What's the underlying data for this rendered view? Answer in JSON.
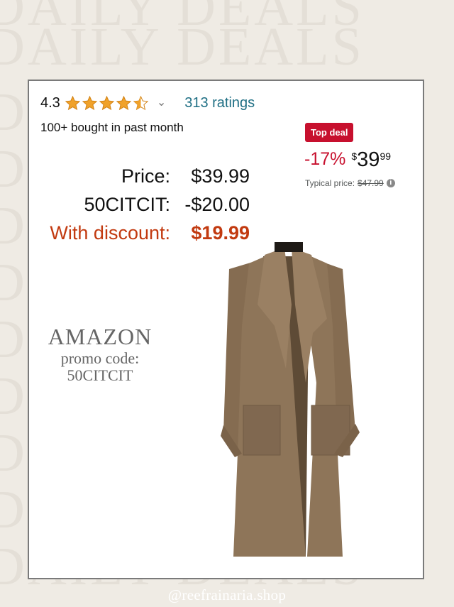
{
  "background": {
    "watermark_text": "DAILY DEALS"
  },
  "listing": {
    "rating_value": "4.3",
    "stars_filled": 4.3,
    "ratings_count": "313 ratings",
    "bought_text": "100+ bought in past month",
    "badge": "Top deal",
    "discount": "-17%",
    "currency": "$",
    "price_whole": "39",
    "price_cents": "99",
    "typical_label": "Typical price:",
    "typical_value": "$47.99"
  },
  "breakdown": [
    {
      "label": "Price:",
      "value": "$39.99"
    },
    {
      "label": "50CITCIT:",
      "value": "-$20.00"
    },
    {
      "label": "With discount:",
      "value": "$19.99"
    }
  ],
  "promo": {
    "brand": "AMAZON",
    "line1": "promo code:",
    "line2": "50CITCIT"
  },
  "footer": {
    "handle": "@reefrainaria.shop"
  },
  "colors": {
    "accent_red": "#c7102e",
    "discount_orange": "#c23a10",
    "link_teal": "#1f6f84",
    "star": "#f0a22b",
    "coat": "#8e7559"
  }
}
